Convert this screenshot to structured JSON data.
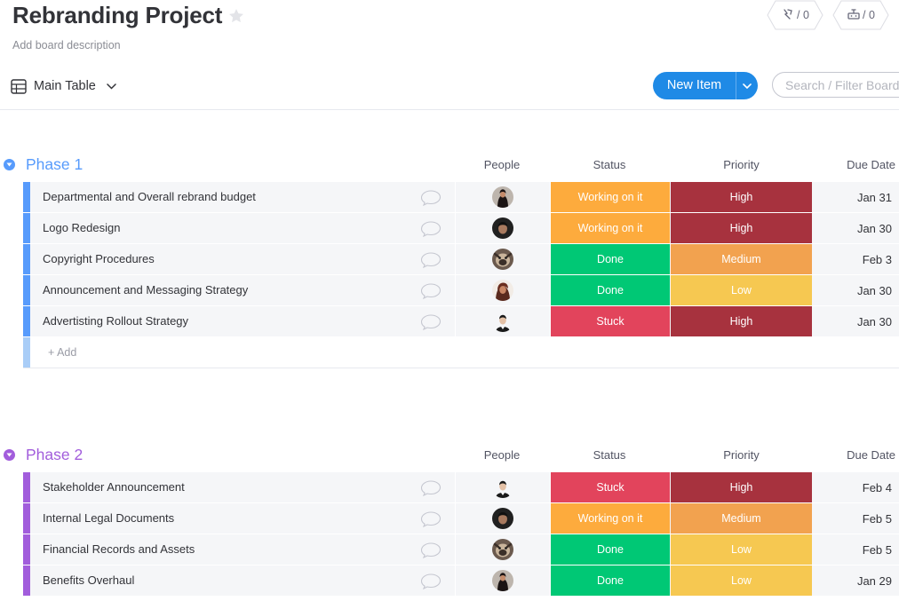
{
  "board": {
    "title": "Rebranding Project",
    "description": "Add board description"
  },
  "header_counters": [
    {
      "icon": "activity-icon",
      "value": "/ 0"
    },
    {
      "icon": "integrations-icon",
      "value": "/ 0"
    }
  ],
  "view": {
    "label": "Main Table"
  },
  "toolbar": {
    "new_item_label": "New Item",
    "search_placeholder": "Search / Filter Board"
  },
  "columns": {
    "people": "People",
    "status": "Status",
    "priority": "Priority",
    "due_date": "Due Date"
  },
  "colors": {
    "working": "#fdab3d",
    "done": "#00c875",
    "stuck": "#e2445c",
    "high": "#a7323e",
    "medium": "#f2a24f",
    "low": "#f6c851",
    "phase1": "#579bfc",
    "phase2": "#a25ddc"
  },
  "groups": [
    {
      "title": "Phase 1",
      "rows": [
        {
          "name": "Departmental and Overall rebrand budget",
          "status": "Working on it",
          "priority": "High",
          "due": "Jan 31"
        },
        {
          "name": "Logo Redesign",
          "status": "Working on it",
          "priority": "High",
          "due": "Jan 30"
        },
        {
          "name": "Copyright Procedures",
          "status": "Done",
          "priority": "Medium",
          "due": "Feb 3"
        },
        {
          "name": "Announcement and Messaging Strategy",
          "status": "Done",
          "priority": "Low",
          "due": "Jan 30"
        },
        {
          "name": "Advertisting Rollout Strategy",
          "status": "Stuck",
          "priority": "High",
          "due": "Jan 30"
        }
      ],
      "add_label": "+ Add"
    },
    {
      "title": "Phase 2",
      "rows": [
        {
          "name": "Stakeholder Announcement",
          "status": "Stuck",
          "priority": "High",
          "due": "Feb 4"
        },
        {
          "name": "Internal Legal Documents",
          "status": "Working on it",
          "priority": "Medium",
          "due": "Feb 5"
        },
        {
          "name": "Financial Records and Assets",
          "status": "Done",
          "priority": "Low",
          "due": "Feb 5"
        },
        {
          "name": "Benefits Overhaul",
          "status": "Done",
          "priority": "Low",
          "due": "Jan 29"
        }
      ]
    }
  ]
}
